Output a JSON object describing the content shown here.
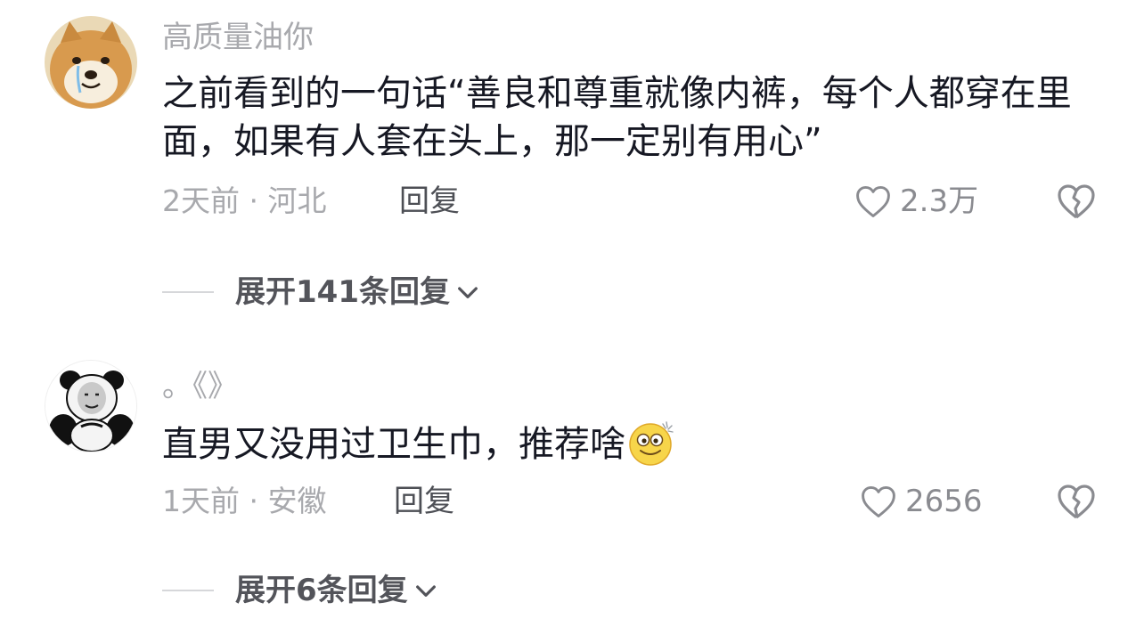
{
  "comments": [
    {
      "username": "高质量油你",
      "text": "之前看到的一句话“善良和尊重就像内裤，每个人都穿在里面，如果有人套在头上，那一定别有用心”",
      "meta": "2天前 · 河北",
      "reply_label": "回复",
      "like_count": "2.3万",
      "expand_label": "展开141条回复",
      "avatar_icon": "shiba-dog-avatar"
    },
    {
      "username": "。《》",
      "text": "直男又没用过卫生巾，推荐啥",
      "meta": "1天前 · 安徽",
      "reply_label": "回复",
      "like_count": "2656",
      "expand_label": "展开6条回复",
      "avatar_icon": "panda-meme-avatar",
      "trailing_emoji": "dizzy-smile-emoji"
    }
  ],
  "colors": {
    "text_primary": "#161823",
    "text_secondary": "#a8a9ad",
    "accent_muted": "#53545a"
  }
}
